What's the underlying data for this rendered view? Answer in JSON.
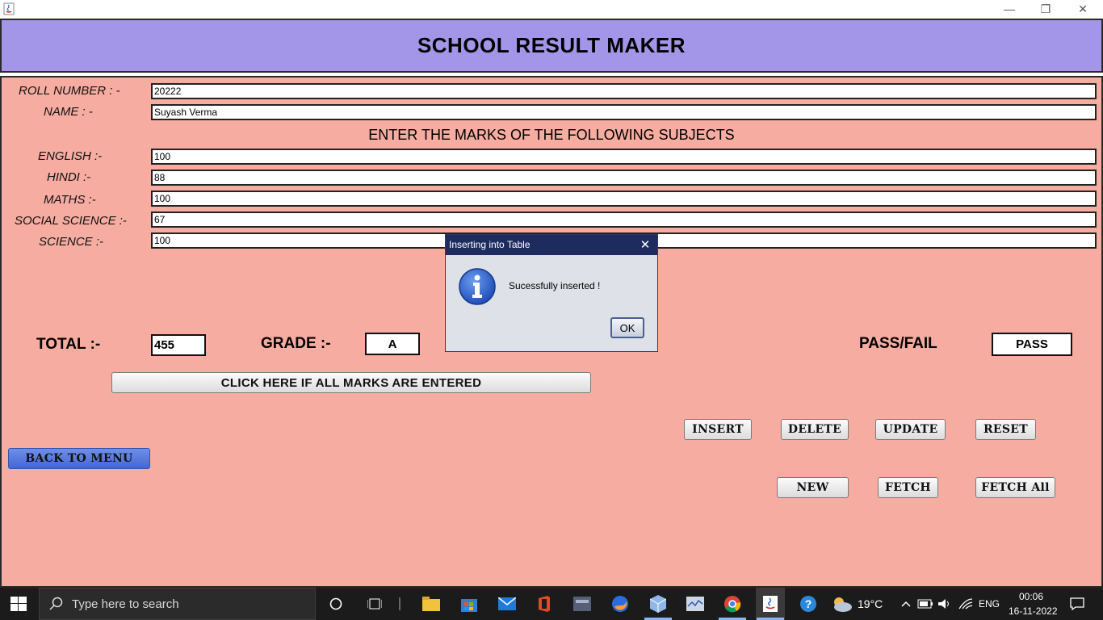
{
  "window": {
    "title": "",
    "controls": {
      "minimize": "—",
      "maximize": "❐",
      "close": "✕"
    }
  },
  "header": {
    "title": "SCHOOL RESULT MAKER"
  },
  "form": {
    "roll_label": "ROLL NUMBER : -",
    "roll_value": "20222",
    "name_label": "NAME : -",
    "name_value": "Suyash Verma",
    "subjects_heading": "ENTER THE MARKS OF THE FOLLOWING SUBJECTS",
    "subjects": [
      {
        "label": "ENGLISH :-",
        "value": "100"
      },
      {
        "label": "HINDI :-",
        "value": "88"
      },
      {
        "label": "MATHS :-",
        "value": "100"
      },
      {
        "label": "SOCIAL SCIENCE :-",
        "value": "67"
      },
      {
        "label": "SCIENCE :-",
        "value": "100"
      }
    ]
  },
  "results": {
    "total_label": "TOTAL :-",
    "total_value": "455",
    "grade_label": "GRADE :-",
    "grade_value": "A",
    "passfail_label": "PASS/FAIL",
    "passfail_value": "PASS"
  },
  "buttons": {
    "compute": "CLICK HERE IF ALL MARKS ARE ENTERED",
    "insert": "INSERT",
    "delete": "DELETE",
    "update": "UPDATE",
    "reset": "RESET",
    "back": "BACK TO MENU",
    "new": "NEW",
    "fetch": "FETCH",
    "fetch_all": "FETCH All"
  },
  "dialog": {
    "title": "Inserting into Table",
    "message": "Sucessfully inserted !",
    "ok": "OK",
    "icon": "info-icon"
  },
  "taskbar": {
    "search_placeholder": "Type here to search",
    "weather": "19°C",
    "language": "ENG",
    "time": "00:06",
    "date": "16-11-2022"
  },
  "colors": {
    "header_bg": "#a396e8",
    "panel_bg": "#f6aca0",
    "dialog_title_bg": "#1e2b5e",
    "back_button_bg": "#4f6fdc"
  }
}
